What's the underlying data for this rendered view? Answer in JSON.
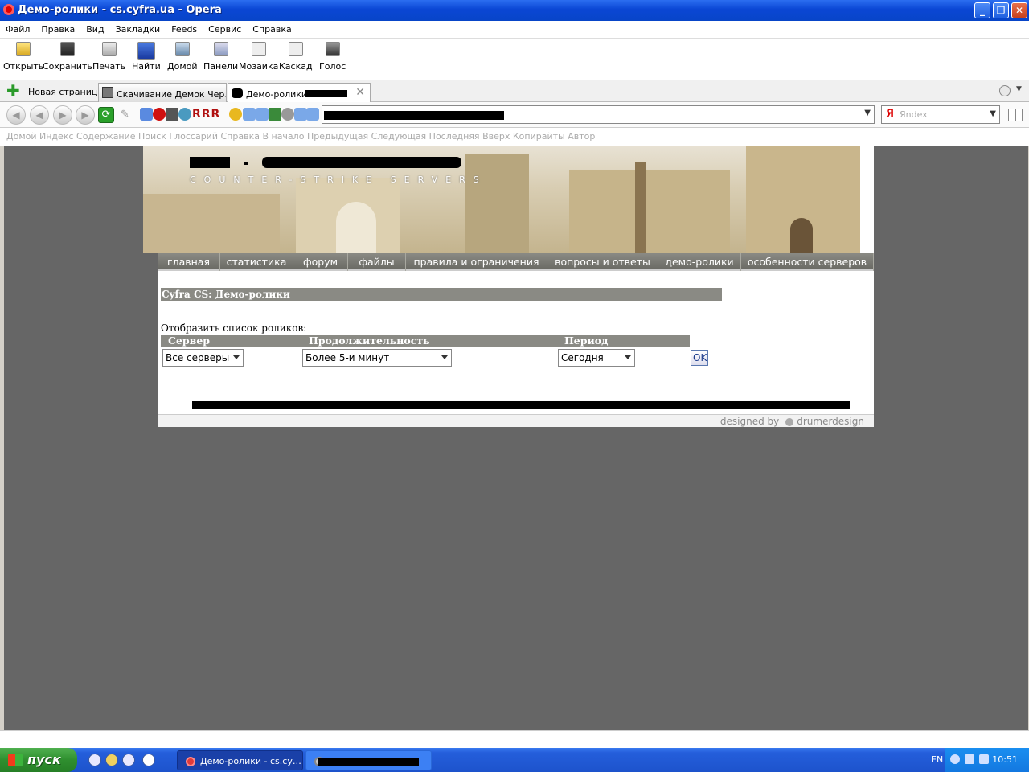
{
  "window": {
    "title": "Демо-ролики - cs.cyfra.ua - Opera"
  },
  "menubar": {
    "items": [
      "Файл",
      "Правка",
      "Вид",
      "Закладки",
      "Feeds",
      "Сервис",
      "Справка"
    ]
  },
  "toolbar": {
    "items": [
      {
        "label": "Открыть",
        "icon": "folder-icon"
      },
      {
        "label": "Сохранить",
        "icon": "floppy-icon"
      },
      {
        "label": "Печать",
        "icon": "printer-icon"
      },
      {
        "label": "Найти",
        "icon": "find-icon"
      },
      {
        "label": "Домой",
        "icon": "home-icon"
      },
      {
        "label": "Панели",
        "icon": "panels-icon"
      },
      {
        "label": "Мозаика",
        "icon": "tile-icon"
      },
      {
        "label": "Каскад",
        "icon": "cascade-icon"
      },
      {
        "label": "Голос",
        "icon": "speaker-icon"
      }
    ]
  },
  "tabs": {
    "new_page": "Новая страница",
    "tab1": "Скачивание Демок Чер…",
    "tab2": "Демо-ролики - "
  },
  "search": {
    "placeholder": "Яndex",
    "logo": "Я"
  },
  "navlinks": {
    "items": [
      "Домой",
      "Индекс",
      "Содержание",
      "Поиск",
      "Глоссарий",
      "Справка",
      "В начало",
      "Предыдущая",
      "Следующая",
      "Последняя",
      "Вверх",
      "Копирайты",
      "Автор"
    ]
  },
  "banner": {
    "subtitle": "COUNTER-STRIKE SERVERS"
  },
  "site_menu": {
    "items": [
      {
        "label": "главная",
        "w": 78
      },
      {
        "label": "статистика",
        "w": 91
      },
      {
        "label": "форум",
        "w": 68
      },
      {
        "label": "файлы",
        "w": 72
      },
      {
        "label": "правила и ограничения",
        "w": 176
      },
      {
        "label": "вопросы и ответы",
        "w": 138
      },
      {
        "label": "демо-ролики",
        "w": 103
      },
      {
        "label": "особенности серверов",
        "w": 165
      }
    ]
  },
  "page": {
    "title": "Cyfra CS: Демо-ролики",
    "show_list": "Отобразить список роликов:",
    "filters": {
      "server_label": "Сервер",
      "server_value": "Все серверы",
      "duration_label": "Продолжительность",
      "duration_value": "Более 5-и минут",
      "period_label": "Период",
      "period_value": "Сегодня",
      "ok": "OK"
    },
    "designed_by": "designed by",
    "designer": "drumerdesign"
  },
  "taskbar": {
    "start": "пуск",
    "task1": "Демо-ролики - cs.cy…",
    "lang": "EN",
    "clock": "10:51"
  },
  "colors": {
    "titlebar": "#0a46d4",
    "menu_gray": "#8a8a84",
    "content_bg": "#666666",
    "taskbar": "#245edb",
    "start": "#2f8f2f"
  }
}
